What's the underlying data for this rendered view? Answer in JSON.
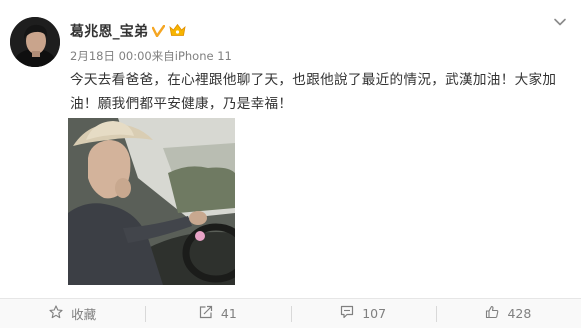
{
  "post": {
    "username": "葛兆恩_宝弟",
    "date": "2月18日 00:00",
    "source_prefix": "来自",
    "source": "iPhone 11",
    "text": "今天去看爸爸，在心裡跟他聊了天，也跟他說了最近的情況，武漢加油！大家加油！願我們都平安健康，乃是幸福！"
  },
  "actions": {
    "favorite_label": "收藏",
    "repost_count": "41",
    "comment_count": "107",
    "like_count": "428"
  },
  "colors": {
    "accent_verified": "#f5a623",
    "vip": "#f7b500",
    "meta_text": "#808080",
    "body_text": "#333333"
  },
  "icons": [
    "verified-icon",
    "vip-icon",
    "chevron-down-icon",
    "star-icon",
    "repost-icon",
    "comment-icon",
    "like-icon"
  ]
}
